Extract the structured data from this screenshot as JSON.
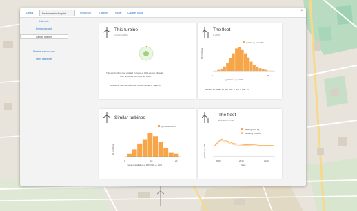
{
  "tabs": [
    {
      "label": "Details"
    },
    {
      "label": "Environmental footprint"
    },
    {
      "label": "Production"
    },
    {
      "label": "Lifetime"
    },
    {
      "label": "Power"
    },
    {
      "label": "Capacity factor"
    }
  ],
  "sidebar": {
    "items": [
      {
        "label": "Life cycle"
      },
      {
        "label": "Energy payback"
      },
      {
        "label": "Carbon footprint"
      },
      {
        "label": "Material resource use"
      },
      {
        "label": "Other categories"
      }
    ]
  },
  "card_this_turbine": {
    "title": "This turbine",
    "subtitle": "g CO2 eq/kWh",
    "text1": "This wind turbine has emitted 8 grams of CO2-eq. per kilowatt-",
    "text2": "hour produced during its life cycle.",
    "text3": "95% of the fleet has a carbon footprint equal or superior"
  },
  "card_fleet": {
    "title": "The fleet",
    "subtitle": "in 2018",
    "legend": "g CO2 eq. per kWh",
    "ylabel": "Nb. turbines",
    "xlabel": "g CO2 eq. per kWh",
    "x_ticks": [
      "0",
      "37"
    ],
    "stats": "Median: 15  Mean: 16  Std. Dev: 5  Min: 6  Max: 37"
  },
  "card_similar": {
    "title": "Similar turbines",
    "legend": "g CO2 eq./kWh",
    "ylabel": "Nb. turbines",
    "xlabel": "For an installation of 1500 kW +/- 20%",
    "x_ticks": [
      "0",
      "10",
      "20"
    ]
  },
  "card_fleet_time": {
    "title": "The fleet",
    "subtitle": "Evolution in time",
    "legend1": "Mean g CO2 eq.",
    "legend2": "Median g CO2 eq.",
    "ylabel": "g CO2 eq./kWh",
    "xlabel": "Years",
    "x_ticks": [
      "2000",
      "2010",
      "2020"
    ]
  },
  "colors": {
    "accent": "#f6a548",
    "link": "#2a75c7",
    "green": "#6fbf4a"
  },
  "chart_data": [
    {
      "type": "bar",
      "title": "The fleet",
      "x_ticks": [
        "0",
        "37"
      ],
      "values": [
        1,
        2,
        3,
        6,
        10,
        16,
        22,
        28,
        30,
        26,
        22,
        17,
        12,
        8,
        6,
        4,
        3,
        2,
        1,
        1
      ]
    },
    {
      "type": "bar",
      "title": "Similar turbines",
      "x_ticks": [
        "0",
        "10",
        "20"
      ],
      "values": [
        2,
        5,
        9,
        12,
        16,
        14,
        10,
        6,
        3,
        2
      ]
    },
    {
      "type": "line",
      "title": "The fleet",
      "series": [
        {
          "name": "Mean g CO2 eq.",
          "values": [
            18,
            30,
            26,
            22,
            21,
            20,
            20,
            19,
            19,
            19
          ]
        },
        {
          "name": "Median g CO2 eq.",
          "values": [
            17,
            28,
            24,
            20,
            19,
            19,
            18,
            18,
            18,
            18
          ]
        }
      ]
    }
  ]
}
